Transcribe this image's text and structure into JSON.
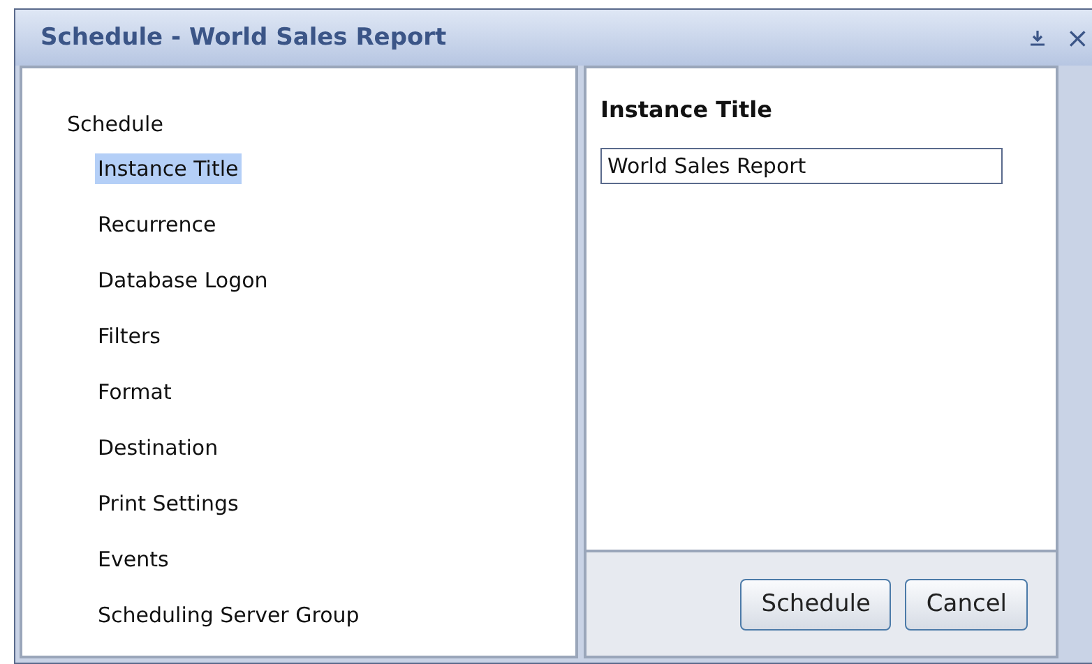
{
  "window": {
    "title": "Schedule - World Sales Report",
    "close_glyph": "×"
  },
  "nav": {
    "items": [
      {
        "label": "Schedule",
        "selected": false,
        "children": [
          {
            "label": "Instance Title",
            "selected": true
          },
          {
            "label": "Recurrence",
            "selected": false
          },
          {
            "label": "Database Logon",
            "selected": false
          },
          {
            "label": "Filters",
            "selected": false
          },
          {
            "label": "Format",
            "selected": false
          },
          {
            "label": "Destination",
            "selected": false
          },
          {
            "label": "Print Settings",
            "selected": false
          },
          {
            "label": "Events",
            "selected": false
          },
          {
            "label": "Scheduling Server Group",
            "selected": false
          }
        ]
      }
    ]
  },
  "panel": {
    "heading": "Instance Title",
    "field_value": "World Sales Report"
  },
  "buttons": [
    "Schedule",
    "Cancel"
  ]
}
